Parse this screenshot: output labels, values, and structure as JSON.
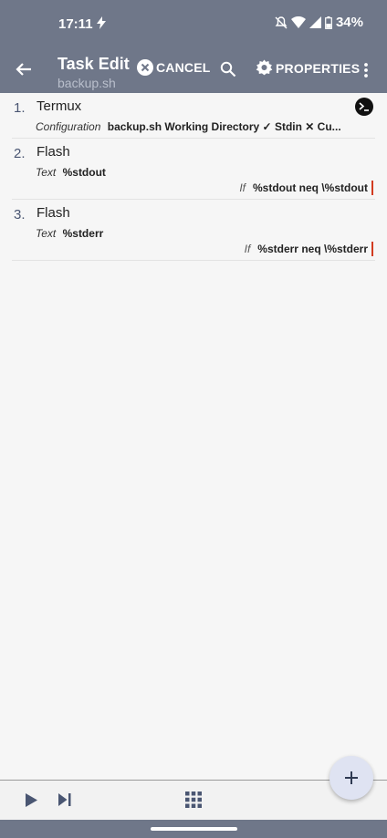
{
  "status": {
    "time": "17:11",
    "battery": "34%",
    "icons": [
      "bolt-icon",
      "mute-icon",
      "wifi-icon",
      "signal-icon",
      "battery-icon"
    ]
  },
  "appbar": {
    "title": "Task Edit",
    "subtitle": "backup.sh",
    "cancel_label": "CANCEL",
    "properties_label": "PROPERTIES"
  },
  "actions": [
    {
      "number": "1.",
      "name": "Termux",
      "params": [
        {
          "key": "Configuration",
          "value": "backup.sh  Working Directory ✓ Stdin ✕ Cu..."
        }
      ],
      "condition": null,
      "icon": "terminal-icon"
    },
    {
      "number": "2.",
      "name": "Flash",
      "params": [
        {
          "key": "Text",
          "value": "%stdout"
        }
      ],
      "condition": {
        "label": "If",
        "expr": "%stdout neq \\%stdout"
      }
    },
    {
      "number": "3.",
      "name": "Flash",
      "params": [
        {
          "key": "Text",
          "value": "%stderr"
        }
      ],
      "condition": {
        "label": "If",
        "expr": "%stderr neq \\%stderr"
      }
    }
  ],
  "bottombar": {
    "icons": [
      "play-icon",
      "skip-next-icon",
      "grid-icon"
    ]
  },
  "fab": {
    "icon": "plus-icon"
  },
  "colors": {
    "bar": "#6f7789",
    "accent": "#4a5672",
    "condition_marker": "#d23b1f",
    "fab": "#dfe3f2"
  }
}
